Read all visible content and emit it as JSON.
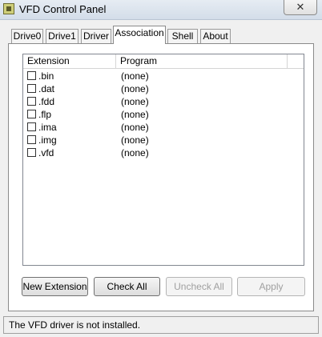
{
  "window": {
    "title": "VFD Control Panel",
    "close_glyph": "✕",
    "app_icon": "floppy-disk-icon"
  },
  "tabs": [
    {
      "label": "Drive0",
      "active": false
    },
    {
      "label": "Drive1",
      "active": false
    },
    {
      "label": "Driver",
      "active": false
    },
    {
      "label": "Association",
      "active": true
    },
    {
      "label": "Shell",
      "active": false
    },
    {
      "label": "About",
      "active": false
    }
  ],
  "association": {
    "columns": [
      "Extension",
      "Program"
    ],
    "rows": [
      {
        "checked": false,
        "extension": ".bin",
        "program": "(none)"
      },
      {
        "checked": false,
        "extension": ".dat",
        "program": "(none)"
      },
      {
        "checked": false,
        "extension": ".fdd",
        "program": "(none)"
      },
      {
        "checked": false,
        "extension": ".flp",
        "program": "(none)"
      },
      {
        "checked": false,
        "extension": ".ima",
        "program": "(none)"
      },
      {
        "checked": false,
        "extension": ".img",
        "program": "(none)"
      },
      {
        "checked": false,
        "extension": ".vfd",
        "program": "(none)"
      }
    ],
    "buttons": {
      "new_extension": "New Extension",
      "check_all": "Check All",
      "uncheck_all": "Uncheck All",
      "apply": "Apply"
    }
  },
  "status": "The VFD driver is not installed."
}
